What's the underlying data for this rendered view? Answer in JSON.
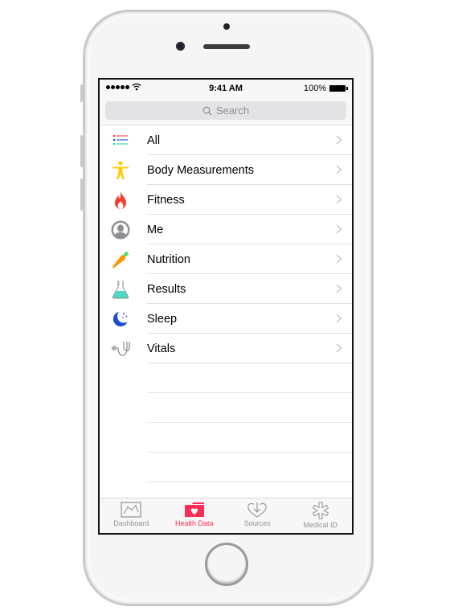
{
  "status_bar": {
    "signal_dots": 5,
    "time": "9:41 AM",
    "battery": "100%"
  },
  "search": {
    "placeholder": "Search"
  },
  "categories": [
    {
      "label": "All",
      "icon": "list-icon"
    },
    {
      "label": "Body Measurements",
      "icon": "body-figure-icon"
    },
    {
      "label": "Fitness",
      "icon": "flame-icon"
    },
    {
      "label": "Me",
      "icon": "person-icon"
    },
    {
      "label": "Nutrition",
      "icon": "carrot-icon"
    },
    {
      "label": "Results",
      "icon": "flask-icon"
    },
    {
      "label": "Sleep",
      "icon": "moon-icon"
    },
    {
      "label": "Vitals",
      "icon": "stethoscope-icon"
    }
  ],
  "tabbar": {
    "tabs": [
      {
        "label": "Dashboard",
        "icon": "chart-icon",
        "active": false
      },
      {
        "label": "Health Data",
        "icon": "folder-heart-icon",
        "active": true
      },
      {
        "label": "Sources",
        "icon": "heart-download-icon",
        "active": false
      },
      {
        "label": "Medical ID",
        "icon": "asterisk-icon",
        "active": false
      }
    ]
  },
  "colors": {
    "accent": "#ff2d55",
    "inactive_tab": "#929292",
    "body_icon": "#ffcc00",
    "fitness_icon": "#ff3b30",
    "nutrition_icon": "#ff9500",
    "results_icon": "#4cd9c0",
    "sleep_icon": "#1e4ad6"
  }
}
